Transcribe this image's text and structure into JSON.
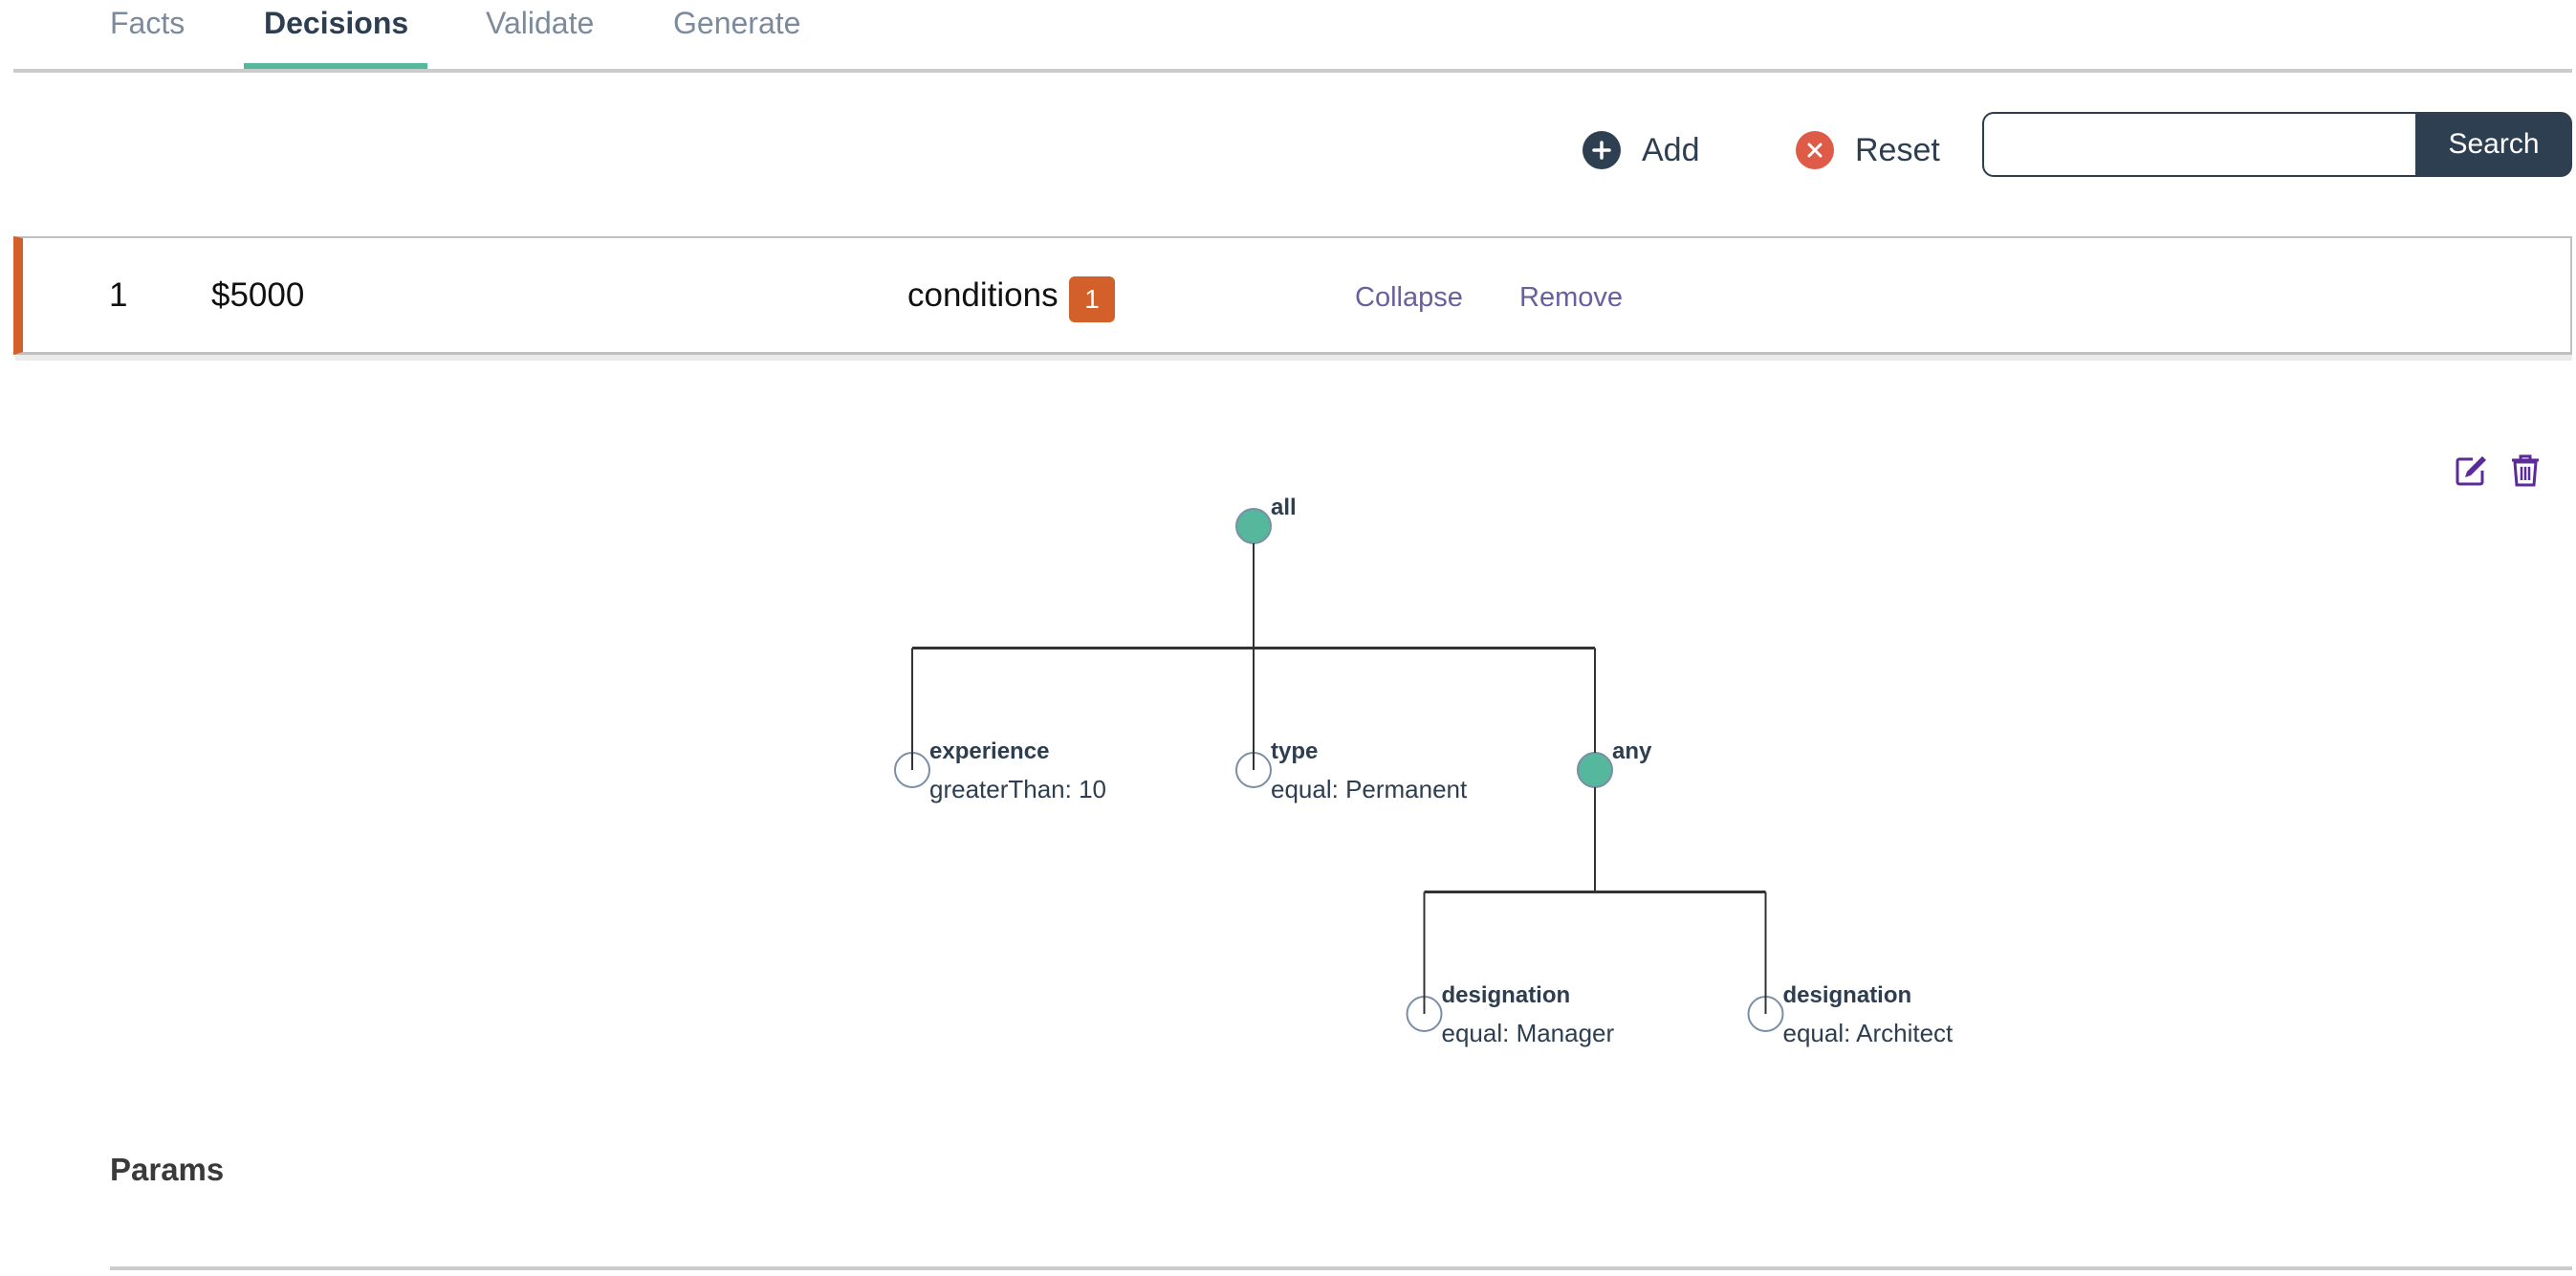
{
  "tabs": [
    {
      "label": "Facts",
      "active": false
    },
    {
      "label": "Decisions",
      "active": true
    },
    {
      "label": "Validate",
      "active": false
    },
    {
      "label": "Generate",
      "active": false
    }
  ],
  "toolbar": {
    "add_label": "Add",
    "add_icon": "plus-circle-icon",
    "reset_label": "Reset",
    "reset_icon": "x-circle-icon",
    "search_value": "",
    "search_placeholder": "",
    "search_label": "Search"
  },
  "decision": {
    "index": "1",
    "event": "$5000",
    "conditions_label": "conditions",
    "conditions_count": "1",
    "collapse_label": "Collapse",
    "remove_label": "Remove",
    "edit_icon": "edit-icon",
    "delete_icon": "trash-icon"
  },
  "tree": {
    "id": "all",
    "name": "all",
    "detail": "",
    "type": "group",
    "children": [
      {
        "id": "exp",
        "name": "experience",
        "detail": "greaterThan: 10",
        "type": "leaf"
      },
      {
        "id": "type",
        "name": "type",
        "detail": "equal: Permanent",
        "type": "leaf"
      },
      {
        "id": "any",
        "name": "any",
        "detail": "",
        "type": "group",
        "children": [
          {
            "id": "des1",
            "name": "designation",
            "detail": "equal: Manager",
            "type": "leaf"
          },
          {
            "id": "des2",
            "name": "designation",
            "detail": "equal: Architect",
            "type": "leaf"
          }
        ]
      }
    ]
  },
  "params": {
    "title": "Params"
  },
  "colors": {
    "accent": "#55b79c",
    "primary": "#2e3f52",
    "danger": "#d9534f",
    "badge": "#d35f2a",
    "link": "#6a5f9e",
    "icon_action": "#5b2b9a"
  }
}
